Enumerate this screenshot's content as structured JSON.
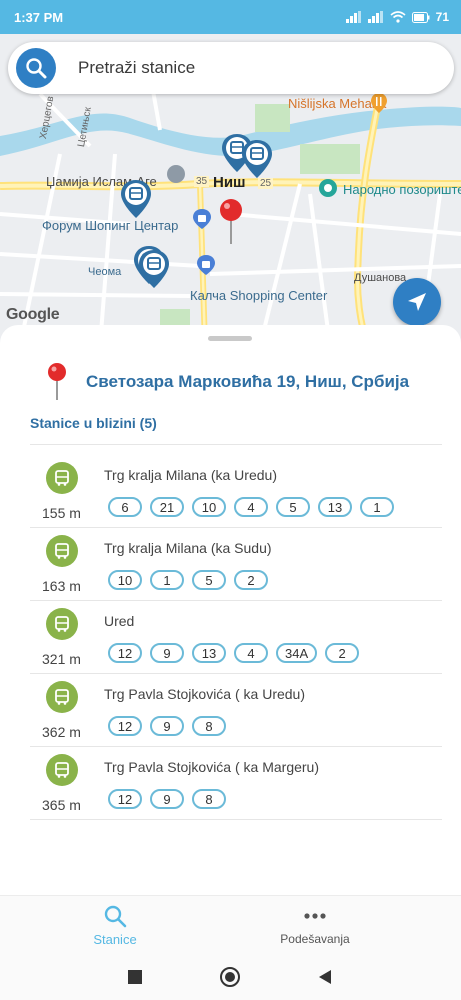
{
  "status_bar": {
    "time": "1:37 PM",
    "battery": "71"
  },
  "search": {
    "placeholder": "Pretraži stanice"
  },
  "map": {
    "labels": {
      "herceg": "Херцегов",
      "cetinska": "Цетињск",
      "nisl": "Nišlijska Mehana",
      "dzamija": "Џамија Ислам-Аге",
      "nis": "Ниш",
      "r35": "35",
      "r25": "25",
      "teatar": "Народно позориште",
      "forum": "Форум Шопинг Центар",
      "ceoma": "Чеома",
      "kalca": "Калча Shopping Center",
      "dusanova": "Душанова"
    },
    "google": "Google"
  },
  "address": "Светозара Марковића 19, Ниш, Србија",
  "nearby_title": "Stanice u blizini (5)",
  "stations": [
    {
      "name": "Trg kralja Milana (ka Uredu)",
      "distance": "155 m",
      "lines": [
        "6",
        "21",
        "10",
        "4",
        "5",
        "13",
        "1"
      ]
    },
    {
      "name": "Trg kralja Milana (ka Sudu)",
      "distance": "163 m",
      "lines": [
        "10",
        "1",
        "5",
        "2"
      ]
    },
    {
      "name": "Ured",
      "distance": "321 m",
      "lines": [
        "12",
        "9",
        "13",
        "4",
        "34A",
        "2"
      ]
    },
    {
      "name": "Trg Pavla Stojkovića ( ka Uredu)",
      "distance": "362 m",
      "lines": [
        "12",
        "9",
        "8"
      ]
    },
    {
      "name": "Trg Pavla Stojkovića ( ka Margeru)",
      "distance": "365 m",
      "lines": [
        "12",
        "9",
        "8"
      ]
    }
  ],
  "tabs": {
    "stations": "Stanice",
    "settings": "Podešavanja"
  },
  "colors": {
    "accent": "#55b8e3",
    "primary_blue": "#2f7fc4",
    "station_green": "#8ab34a",
    "chip_border": "#6bbad8",
    "title_blue": "#2f6fa3"
  },
  "icons": {
    "search": "search-icon",
    "location": "navigation-arrow-icon",
    "pin": "red-map-pin-icon",
    "bus": "bus-icon",
    "more": "more-dots-icon"
  }
}
